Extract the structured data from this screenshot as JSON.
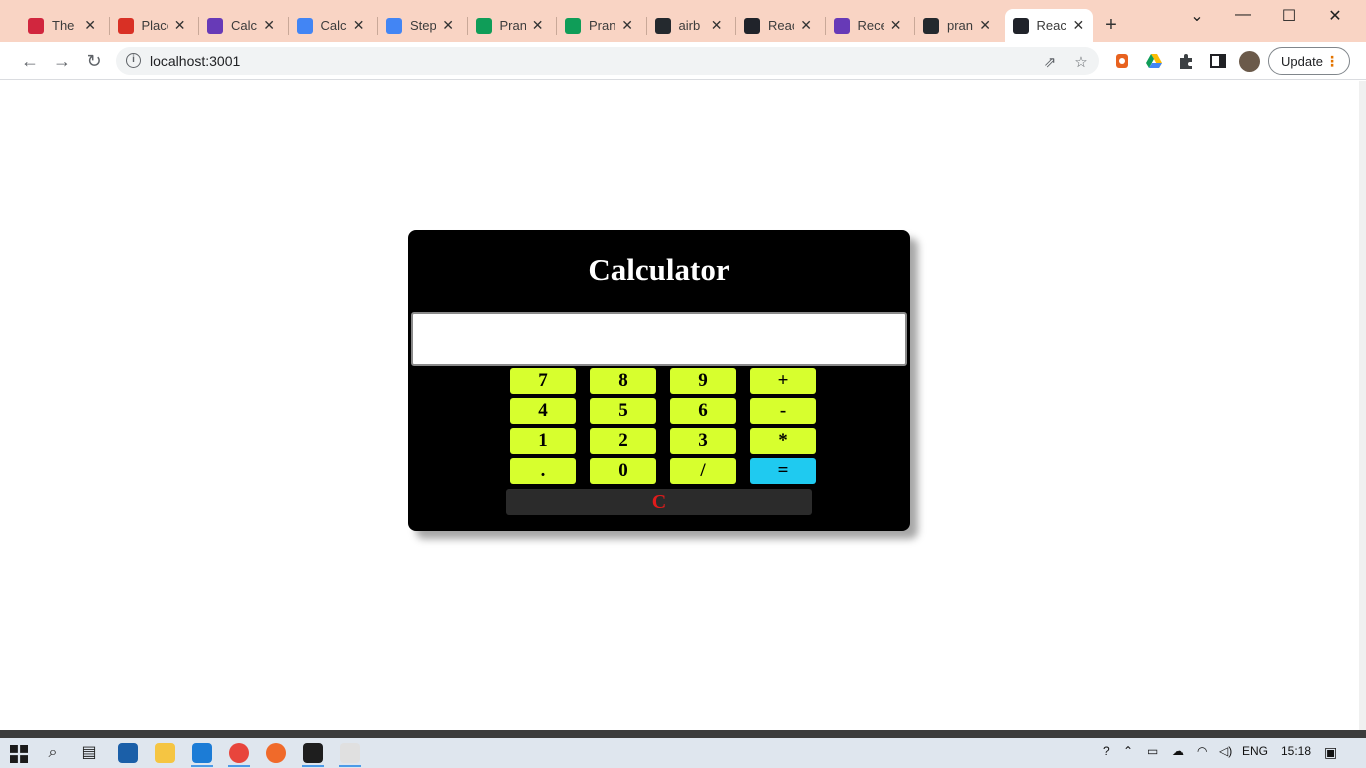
{
  "browser": {
    "tabs": [
      {
        "title": "The",
        "favicon": "netflix-like-icon",
        "color": "#d1263e",
        "active": false
      },
      {
        "title": "Place",
        "favicon": "gmail-icon",
        "color": "#d93025",
        "active": false
      },
      {
        "title": "Calcu",
        "favicon": "forms-icon",
        "color": "#673ab7",
        "active": false
      },
      {
        "title": "Calcu",
        "favicon": "docs-icon",
        "color": "#4285f4",
        "active": false
      },
      {
        "title": "Step",
        "favicon": "docs-icon",
        "color": "#4285f4",
        "active": false
      },
      {
        "title": "Pran",
        "favicon": "drive-icon",
        "color": "#0f9d58",
        "active": false
      },
      {
        "title": "Pran",
        "favicon": "sheets-icon",
        "color": "#0f9d58",
        "active": false
      },
      {
        "title": "airb",
        "favicon": "github-icon",
        "color": "#24292e",
        "active": false
      },
      {
        "title": "Reac",
        "favicon": "react-icon",
        "color": "#20232a",
        "active": false
      },
      {
        "title": "Rece",
        "favicon": "forms-icon",
        "color": "#673ab7",
        "active": false
      },
      {
        "title": "pran",
        "favicon": "github-icon",
        "color": "#24292e",
        "active": false
      },
      {
        "title": "Reac",
        "favicon": "react-icon",
        "color": "#20232a",
        "active": true
      }
    ],
    "new_tab": "+",
    "window_controls": {
      "dropdown": "⌄",
      "minimize": "—",
      "maximize": "☐",
      "close": "✕"
    },
    "url": "localhost:3001",
    "update_label": "Update",
    "menu_dots": "⋮"
  },
  "calculator": {
    "title": "Calculator",
    "display_value": "",
    "keys": [
      [
        "7",
        "8",
        "9",
        "+"
      ],
      [
        "4",
        "5",
        "6",
        "-"
      ],
      [
        "1",
        "2",
        "3",
        "*"
      ],
      [
        ".",
        "0",
        "/",
        "="
      ]
    ],
    "clear_label": "C",
    "colors": {
      "panel": "#000000",
      "key": "#d7ff2e",
      "equals": "#1fcaf0",
      "clear_bg": "#2b2b2b",
      "clear_text": "#e01b1b"
    }
  },
  "taskbar": {
    "language": "ENG",
    "time": "15:18"
  }
}
